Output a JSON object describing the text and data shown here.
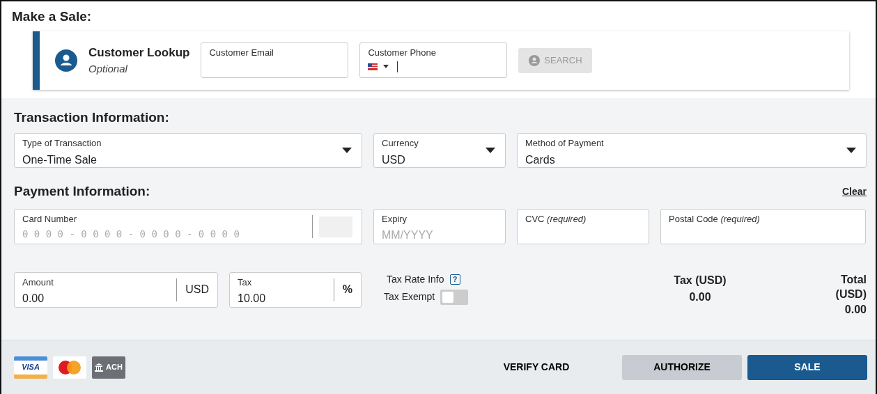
{
  "title": "Make a Sale:",
  "customer_lookup": {
    "title": "Customer Lookup",
    "subtitle": "Optional",
    "email": {
      "label": "Customer Email"
    },
    "phone": {
      "label": "Customer Phone"
    },
    "search_button": {
      "label": "SEARCH",
      "disabled": true
    }
  },
  "transaction": {
    "heading": "Transaction Information:",
    "fields": [
      {
        "label": "Type of Transaction",
        "value": "One-Time Sale"
      },
      {
        "label": "Currency",
        "value": "USD"
      },
      {
        "label": "Method of Payment",
        "value": "Cards"
      }
    ]
  },
  "payment": {
    "heading": "Payment Information:",
    "clear_link": "Clear",
    "card_number": {
      "label": "Card Number",
      "placeholder": "0 0 0 0 - 0 0 0 0 - 0 0 0 0 - 0 0 0 0"
    },
    "expiry": {
      "label": "Expiry",
      "placeholder": "MM/YYYY"
    },
    "cvc": {
      "label": "CVC *(required)*"
    },
    "postal_code": {
      "label": "Postal Code *(required)*"
    },
    "amount": {
      "label": "Amount",
      "value": "0.00",
      "unit": "USD"
    },
    "tax": {
      "label": "Tax",
      "value": "10.00",
      "unit": "%"
    },
    "tax_rate_info": "Tax Rate Info",
    "help_icon": "?",
    "tax_exempt": {
      "label": "Tax Exempt",
      "on": false
    },
    "tax_total": {
      "label": "Tax (USD)",
      "value": "0.00"
    },
    "total": {
      "label": "Total (USD)",
      "value": "0.00"
    }
  },
  "footer": {
    "card_logos": [
      {
        "kind": "visa",
        "text": "VISA"
      },
      {
        "kind": "mastercard"
      },
      {
        "kind": "ach",
        "text": "ACH"
      }
    ],
    "buttons": [
      {
        "kind": "link",
        "label": "VERIFY CARD"
      },
      {
        "kind": "secondary",
        "label": "AUTHORIZE"
      },
      {
        "kind": "primary",
        "label": "SALE"
      }
    ]
  }
}
